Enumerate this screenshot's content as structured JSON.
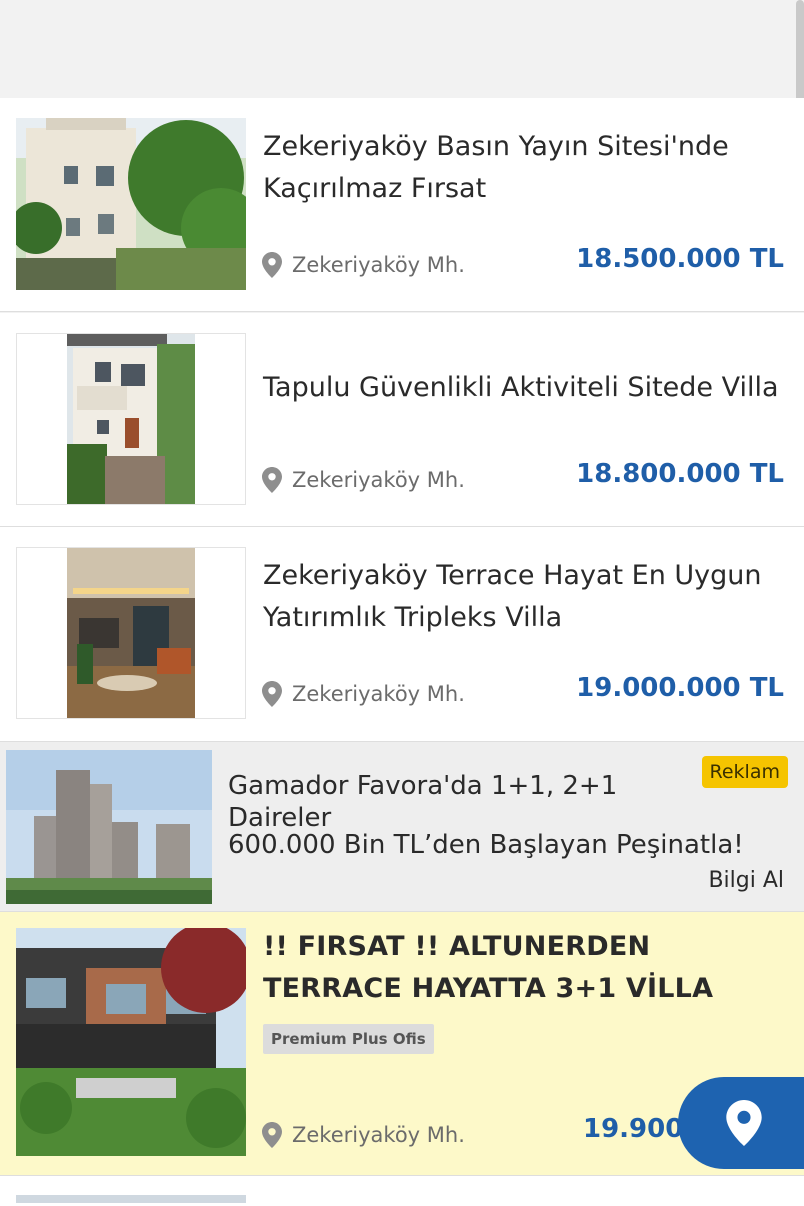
{
  "listings": [
    {
      "title": "Zekeriyaköy Basın Yayın Sitesi'nde Kaçırılmaz Fırsat",
      "location": "Zekeriyaköy Mh.",
      "price": "18.500.000 TL"
    },
    {
      "title": "Tapulu Güvenlikli Aktiviteli Sitede Villa",
      "location": "Zekeriyaköy Mh.",
      "price": "18.800.000 TL"
    },
    {
      "title": "Zekeriyaköy Terrace Hayat En Uygun Yatırımlık Tripleks Villa",
      "location": "Zekeriyaköy Mh.",
      "price": "19.000.000 TL"
    },
    {
      "title": "!! FIRSAT !! ALTUNERDEN TERRACE HAYATTA 3+1 VİLLA",
      "location": "Zekeriyaköy Mh.",
      "price": "19.900",
      "badge": "Premium Plus Ofis"
    }
  ],
  "ad": {
    "title": "Gamador Favora'da 1+1, 2+1 Daireler",
    "subtitle": "600.000 Bin TL’den Başlayan Peşinatla!",
    "badge": "Reklam",
    "link": "Bilgi Al"
  },
  "icons": {
    "location": "location-pin-icon",
    "map_fab": "map-pin-icon"
  },
  "colors": {
    "price": "#1f5ea8",
    "highlight_bg": "#fdf9c9",
    "ad_badge": "#f5c400",
    "fab": "#1e63b0"
  }
}
